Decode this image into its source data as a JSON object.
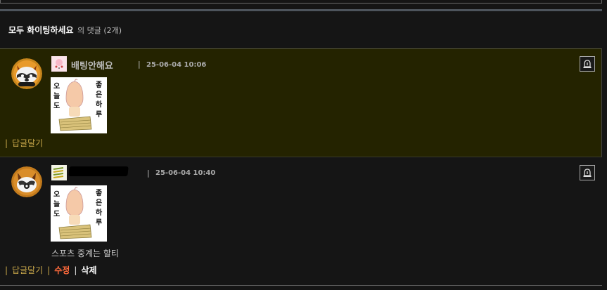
{
  "header": {
    "title_name": "모두 화이팅하세요",
    "title_suffix": "의 댓글",
    "count": "(2개)"
  },
  "comments": [
    {
      "nickname": "배팅안해요",
      "nickname_redacted": false,
      "date": "25-06-04 10:06",
      "sticker": {
        "left_text": [
          "오",
          "늘",
          "도"
        ],
        "right_text": [
          "좋",
          "은",
          "하",
          "루"
        ]
      },
      "text": "",
      "actions": {
        "reply": "답글달기"
      }
    },
    {
      "nickname": "",
      "nickname_redacted": true,
      "date": "25-06-04 10:40",
      "sticker": {
        "left_text": [
          "오",
          "늘",
          "도"
        ],
        "right_text": [
          "좋",
          "은",
          "하",
          "루"
        ]
      },
      "text": "스포츠 중계는 할티",
      "actions": {
        "reply": "답글달기",
        "edit": "수정",
        "delete": "삭제"
      }
    }
  ],
  "separator": "|",
  "colors": {
    "background": "#151515",
    "highlight_row": "#242300",
    "reply_link": "#c9a84a",
    "edit_link": "#ff6a3c"
  },
  "icons": {
    "report": "siren-icon",
    "level_1": "level-badge-icon",
    "level_2": "level-badge-icon"
  }
}
